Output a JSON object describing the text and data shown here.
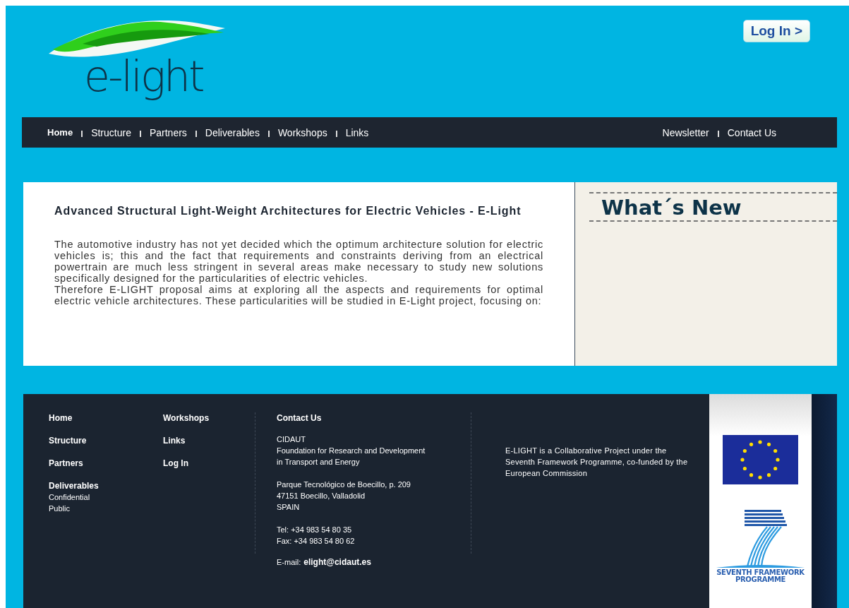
{
  "logo": {
    "text": "e-light"
  },
  "login_button": {
    "label": "Log In >"
  },
  "nav": {
    "left": [
      {
        "label": "Home",
        "selected": true
      },
      {
        "label": "Structure",
        "selected": false
      },
      {
        "label": "Partners",
        "selected": false
      },
      {
        "label": "Deliverables",
        "selected": false
      },
      {
        "label": "Workshops",
        "selected": false
      },
      {
        "label": "Links",
        "selected": false
      }
    ],
    "right": [
      {
        "label": "Newsletter",
        "selected": false
      },
      {
        "label": "Contact Us",
        "selected": false
      }
    ]
  },
  "article": {
    "title": "Advanced Structural Light-Weight Architectures for Electric Vehicles - E-Light",
    "paragraphs": [
      "The automotive industry has not yet decided which the optimum architecture solution for electric vehicles is; this and the fact that requirements and constraints deriving from an electrical powertrain are much less stringent in several areas make necessary to study new solutions specifically designed for the particularities of electric vehicles.",
      "Therefore E-LIGHT proposal aims at exploring all the aspects and requirements for optimal electric vehicle architectures. These particularities will be studied in E-Light project, focusing on:"
    ]
  },
  "whats_new": {
    "title": "What´s New"
  },
  "footer": {
    "links_column_1": [
      {
        "label": "Home"
      },
      {
        "label": "Structure"
      },
      {
        "label": "Partners"
      },
      {
        "label": "Deliverables",
        "children": [
          {
            "label": "Confidential"
          },
          {
            "label": "Public"
          }
        ]
      }
    ],
    "links_column_2": [
      {
        "label": "Workshops"
      },
      {
        "label": "Links"
      },
      {
        "label": "Log In"
      }
    ],
    "contact": {
      "title": "Contact Us",
      "blocks": [
        [
          "CIDAUT",
          "Foundation for Research and Development",
          "in Transport and Energy"
        ],
        [
          "Parque Tecnológico de Boecillo, p. 209",
          "47151 Boecillo, Valladolid",
          "SPAIN"
        ],
        [
          "Tel: +34 983 54 80 35",
          "Fax: +34 983 54 80 62"
        ]
      ],
      "email_label": "E-mail:",
      "email": "elight@cidaut.es"
    },
    "note": "E-LIGHT is a Collaborative Project under the Seventh Framework Programme, co-funded by the European Commission",
    "fp7_caption": [
      "SEVENTH FRAMEWORK",
      "PROGRAMME"
    ]
  }
}
